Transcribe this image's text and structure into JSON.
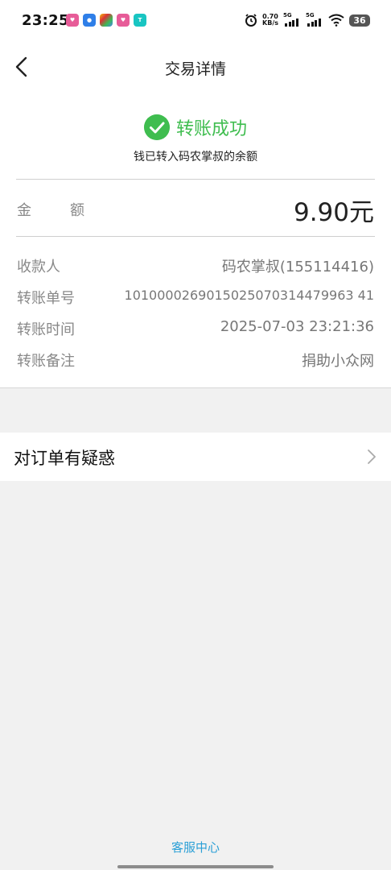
{
  "status_bar": {
    "time": "23:25",
    "net_speed_value": "0.70",
    "net_speed_unit": "KB/s",
    "sim1": "5G",
    "sim2": "5G",
    "battery": "36"
  },
  "header": {
    "title": "交易详情"
  },
  "result": {
    "status": "转账成功",
    "message": "钱已转入码农掌叔的余额",
    "accent_color": "#3fbd4f"
  },
  "amount": {
    "label_chars": [
      "金",
      "额"
    ],
    "value": "9.90元"
  },
  "details": [
    {
      "label": "收款人",
      "value": "码农掌叔(155114416)"
    },
    {
      "label": "转账单号",
      "value": "1010000269015025070314479963 41"
    },
    {
      "label": "转账时间",
      "value": "2025-07-03 23:21:36"
    },
    {
      "label": "转账备注",
      "value": "捐助小众网"
    }
  ],
  "doubt": {
    "label": "对订单有疑惑"
  },
  "footer": {
    "service": "客服中心"
  }
}
